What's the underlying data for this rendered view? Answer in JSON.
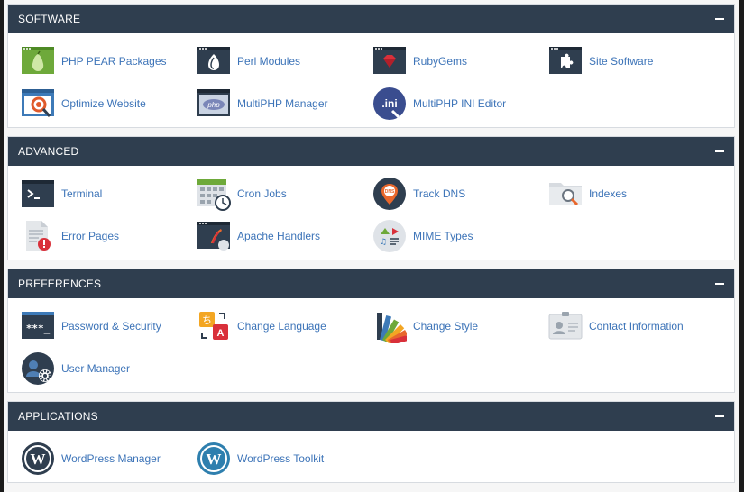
{
  "colors": {
    "header_bg": "#2f3e4f",
    "link": "#3d74b8",
    "panel_border": "#d7dbe0"
  },
  "sections": [
    {
      "title": "SOFTWARE",
      "items": [
        {
          "label": "PHP PEAR Packages",
          "icon": "php-pear-icon"
        },
        {
          "label": "Perl Modules",
          "icon": "perl-modules-icon"
        },
        {
          "label": "RubyGems",
          "icon": "rubygems-icon"
        },
        {
          "label": "Site Software",
          "icon": "site-software-icon"
        },
        {
          "label": "Optimize Website",
          "icon": "optimize-website-icon"
        },
        {
          "label": "MultiPHP Manager",
          "icon": "multiphp-manager-icon"
        },
        {
          "label": "MultiPHP INI Editor",
          "icon": "multiphp-ini-editor-icon"
        }
      ]
    },
    {
      "title": "ADVANCED",
      "items": [
        {
          "label": "Terminal",
          "icon": "terminal-icon"
        },
        {
          "label": "Cron Jobs",
          "icon": "cron-jobs-icon"
        },
        {
          "label": "Track DNS",
          "icon": "track-dns-icon"
        },
        {
          "label": "Indexes",
          "icon": "indexes-icon"
        },
        {
          "label": "Error Pages",
          "icon": "error-pages-icon"
        },
        {
          "label": "Apache Handlers",
          "icon": "apache-handlers-icon"
        },
        {
          "label": "MIME Types",
          "icon": "mime-types-icon"
        }
      ]
    },
    {
      "title": "PREFERENCES",
      "items": [
        {
          "label": "Password & Security",
          "icon": "password-security-icon"
        },
        {
          "label": "Change Language",
          "icon": "change-language-icon"
        },
        {
          "label": "Change Style",
          "icon": "change-style-icon"
        },
        {
          "label": "Contact Information",
          "icon": "contact-information-icon"
        },
        {
          "label": "User Manager",
          "icon": "user-manager-icon"
        }
      ]
    },
    {
      "title": "APPLICATIONS",
      "items": [
        {
          "label": "WordPress Manager",
          "icon": "wordpress-manager-icon"
        },
        {
          "label": "WordPress Toolkit",
          "icon": "wordpress-toolkit-icon"
        }
      ]
    }
  ]
}
